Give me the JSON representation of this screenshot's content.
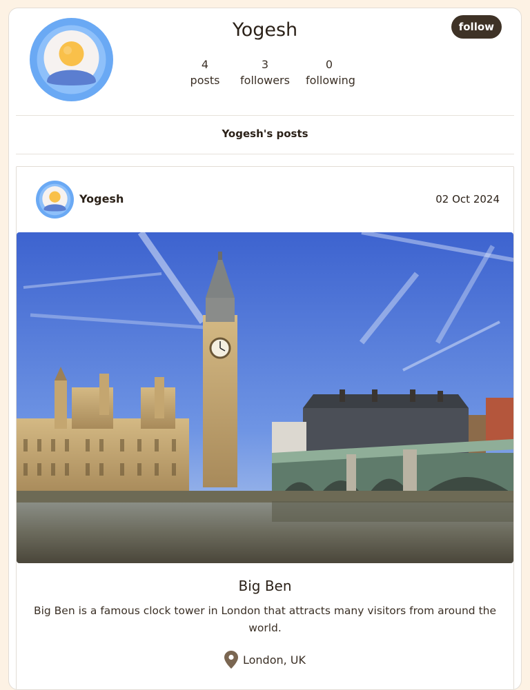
{
  "profile": {
    "name": "Yogesh",
    "follow_label": "follow",
    "stats": {
      "posts_count": "4",
      "posts_label": "posts",
      "followers_count": "3",
      "followers_label": "followers",
      "following_count": "0",
      "following_label": "following"
    }
  },
  "section_title": "Yogesh's posts",
  "post": {
    "author": "Yogesh",
    "date": "02 Oct 2024",
    "title": "Big Ben",
    "body": "Big Ben is a famous clock tower in London that attracts many visitors from around the world.",
    "location": "London, UK",
    "image_subject": "big-ben-westminster-photo"
  },
  "icons": {
    "avatar": "user-avatar-icon",
    "location": "map-pin-icon"
  },
  "colors": {
    "page_background": "#fdf2e4",
    "accent_dark": "#3e3226",
    "avatar_ring": "#6aa9f4",
    "avatar_head": "#f9c04a",
    "avatar_body": "#5b7ed0"
  }
}
